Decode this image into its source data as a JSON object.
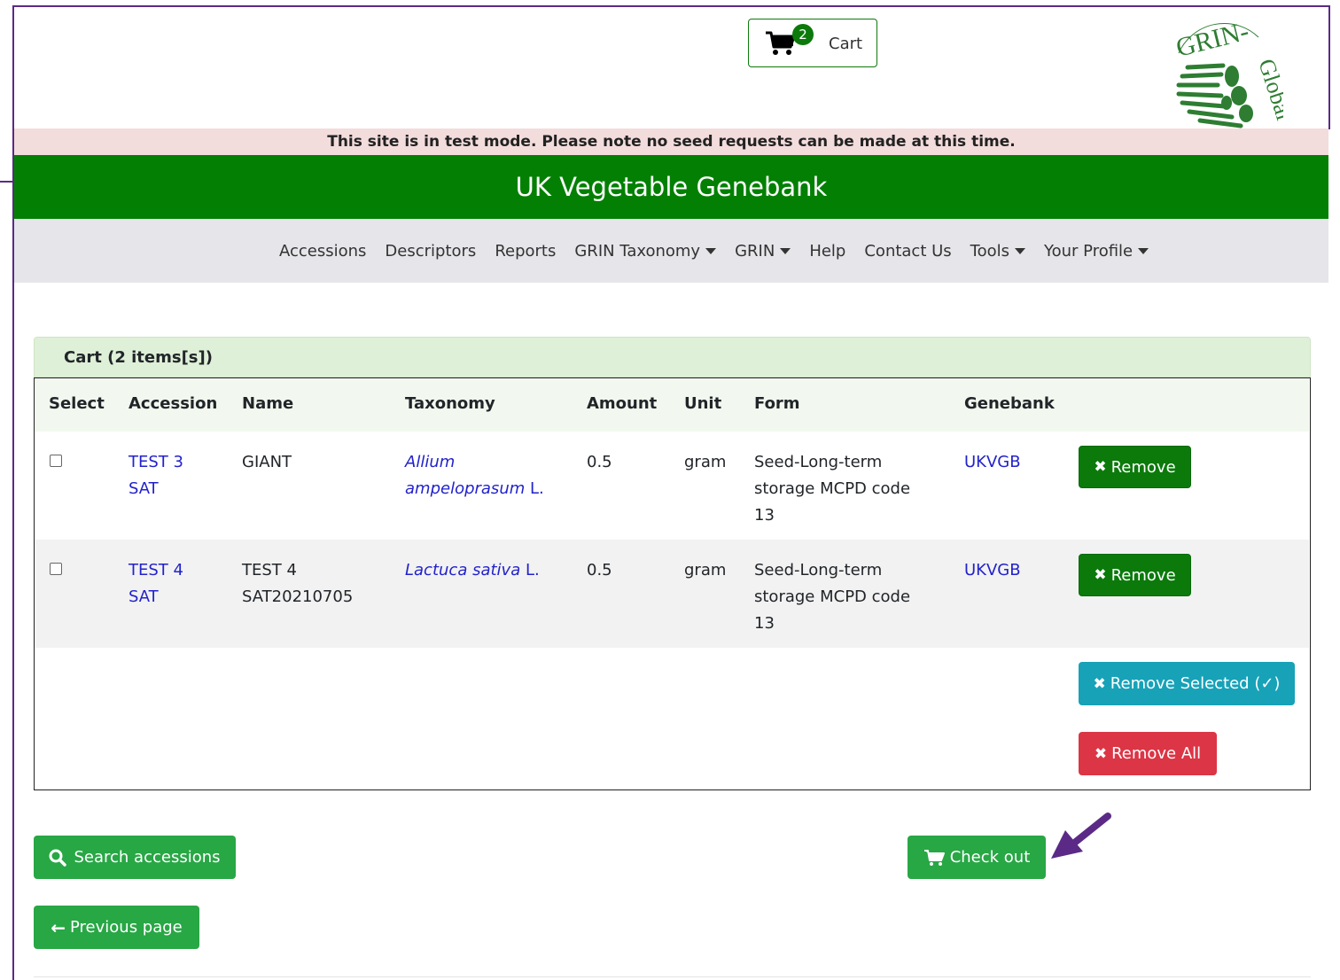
{
  "header": {
    "cart_count": "2",
    "cart_label": "Cart",
    "logo_text": "GRIN-Global"
  },
  "banner": {
    "test_mode": "This site is in test mode. Please note no seed requests can be made at this time.",
    "site_title": "UK Vegetable Genebank"
  },
  "nav": {
    "items": [
      "Accessions",
      "Descriptors",
      "Reports",
      "GRIN Taxonomy",
      "GRIN",
      "Help",
      "Contact Us",
      "Tools",
      "Your Profile"
    ]
  },
  "cart": {
    "title": "Cart (2 items[s])",
    "columns": [
      "Select",
      "Accession",
      "Name",
      "Taxonomy",
      "Amount",
      "Unit",
      "Form",
      "Genebank"
    ],
    "rows": [
      {
        "accession_l1": "TEST 3",
        "accession_l2": "SAT",
        "name_l1": "GIANT",
        "name_l2": "",
        "taxonomy_genus": "Allium",
        "taxonomy_species": "ampeloprasum",
        "taxonomy_author": "L.",
        "amount": "0.5",
        "unit": "gram",
        "form_l1": "Seed-Long-term",
        "form_l2": "storage MCPD code",
        "form_l3": "13",
        "genebank": "UKVGB",
        "remove_label": "Remove"
      },
      {
        "accession_l1": "TEST 4",
        "accession_l2": "SAT",
        "name_l1": "TEST 4",
        "name_l2": "SAT20210705",
        "taxonomy_genus": "Lactuca",
        "taxonomy_species": "sativa",
        "taxonomy_author": "L.",
        "amount": "0.5",
        "unit": "gram",
        "form_l1": "Seed-Long-term",
        "form_l2": "storage MCPD code",
        "form_l3": "13",
        "genebank": "UKVGB",
        "remove_label": "Remove"
      }
    ],
    "remove_selected_label": "Remove Selected (✓)",
    "remove_all_label": "Remove All"
  },
  "actions": {
    "search_label": "Search accessions",
    "checkout_label": "Check out",
    "previous_label": "Previous page"
  },
  "colors": {
    "brand_green": "#038003",
    "annotation_purple": "#5b2a86"
  }
}
